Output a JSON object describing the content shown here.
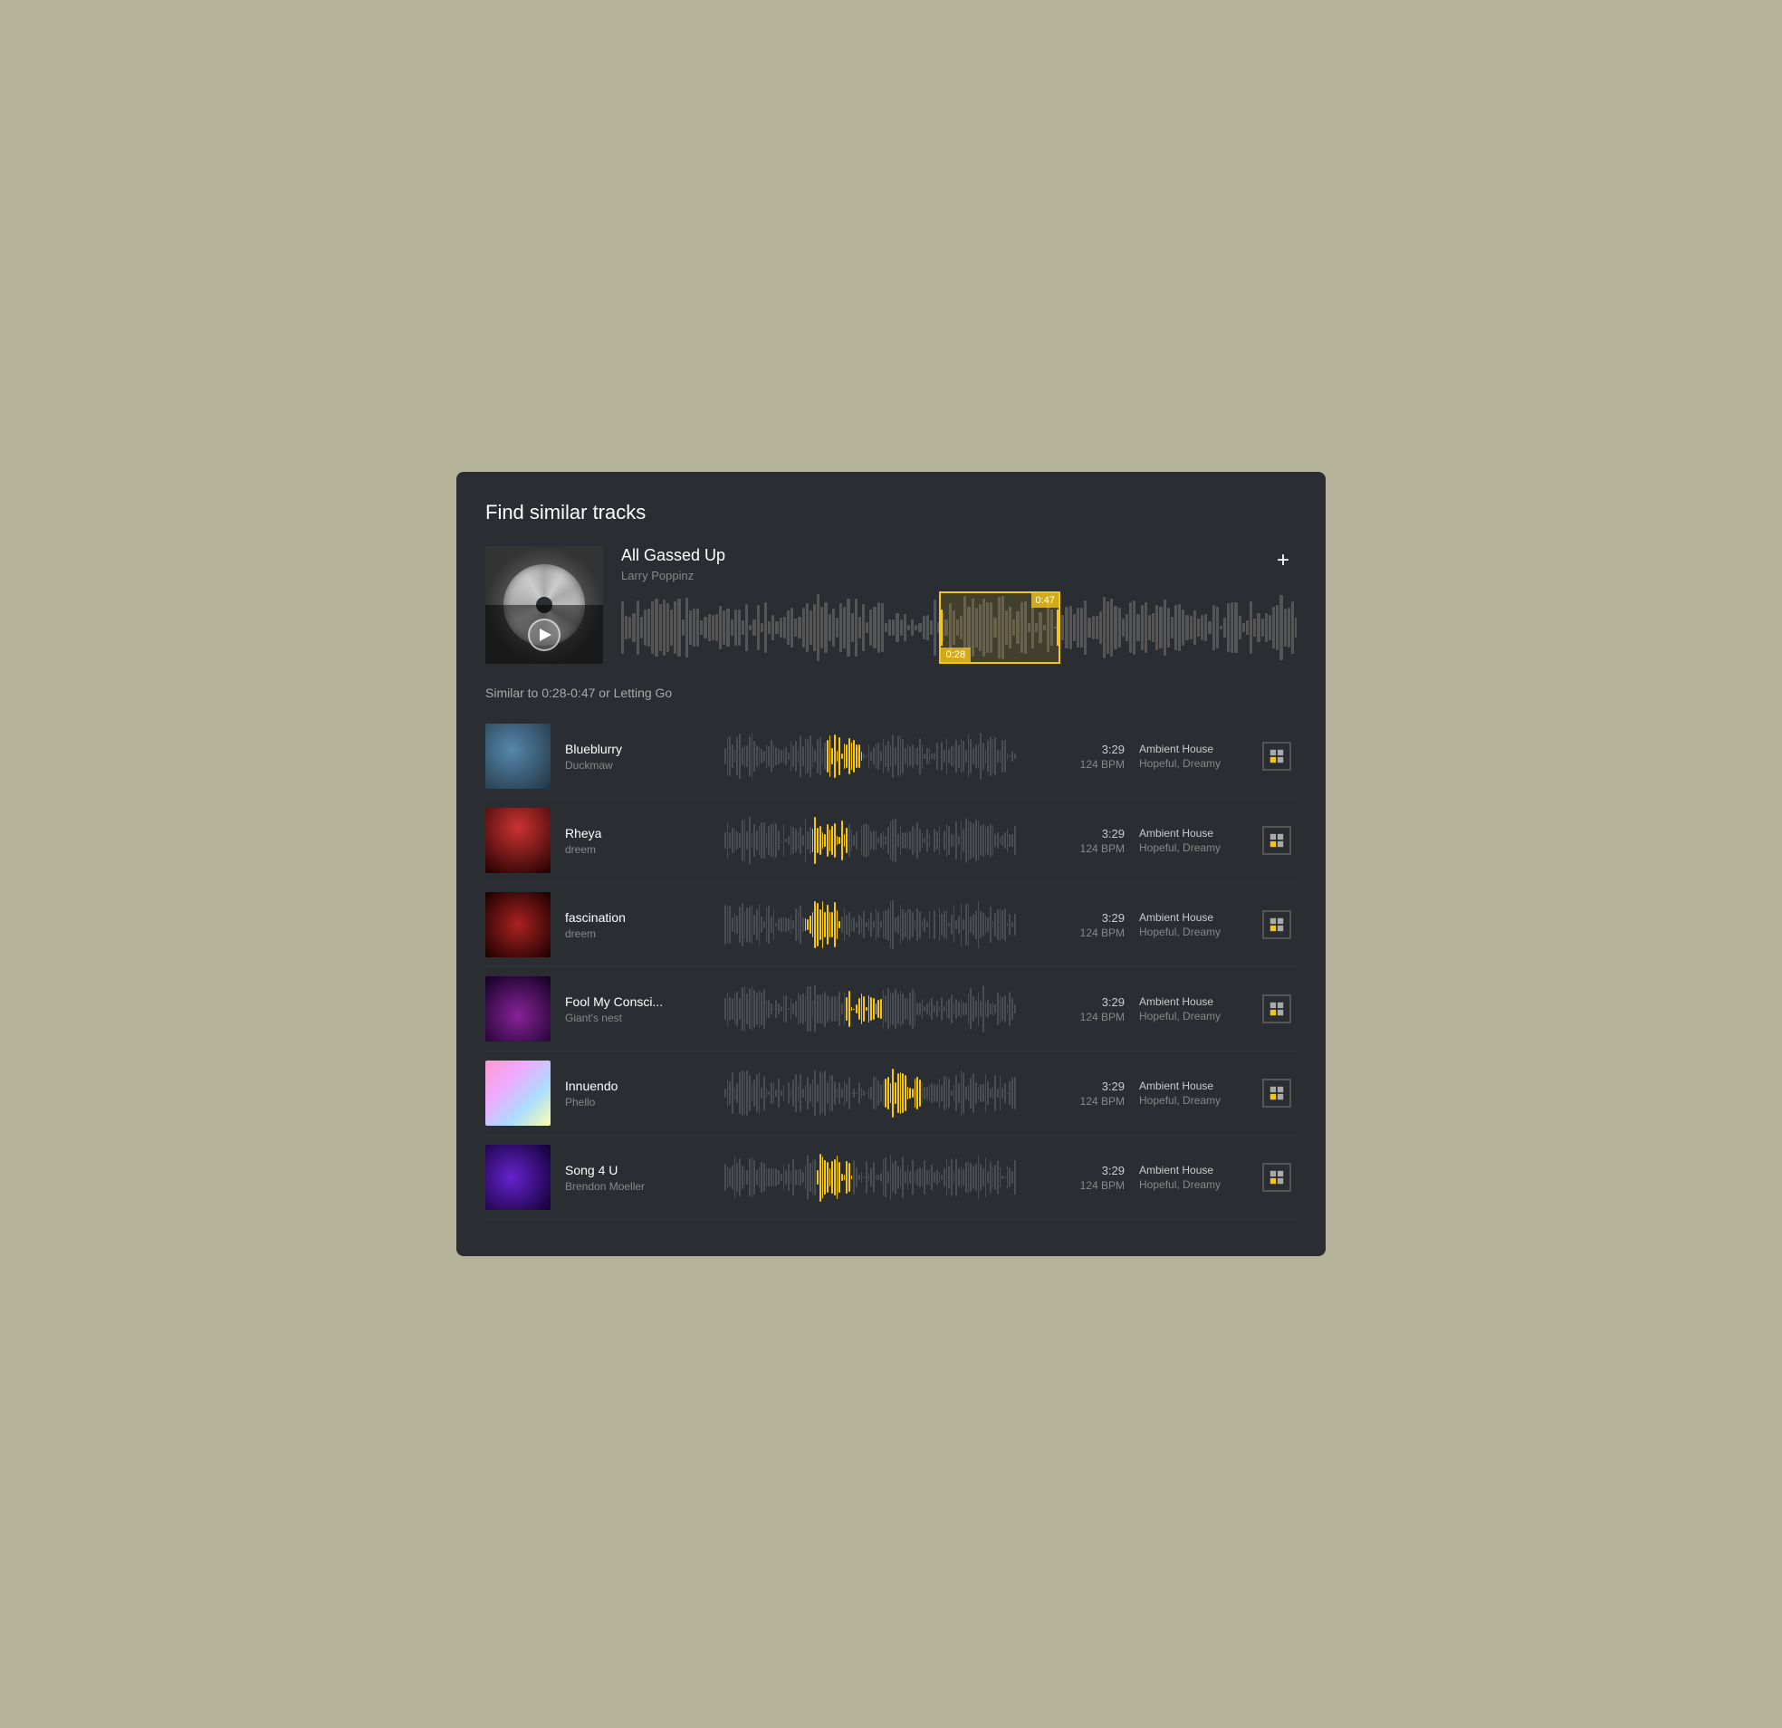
{
  "page": {
    "title": "Find similar tracks",
    "bg_color": "#b5b49a",
    "window_bg": "#2a2d31"
  },
  "hero": {
    "track_title": "All Gassed Up",
    "artist": "Larry Poppinz",
    "add_label": "+",
    "selection": {
      "start_time": "0:28",
      "end_time": "0:47"
    }
  },
  "similar_header": "Similar to 0:28-0:47 or Letting Go",
  "tracks": [
    {
      "title": "Blueblurry",
      "artist": "Duckmaw",
      "duration": "3:29",
      "bpm": "124 BPM",
      "genre": "Ambient House",
      "mood": "Hopeful, Dreamy",
      "thumb_class": "thumb-blueblurry",
      "highlight_pos": 0.35
    },
    {
      "title": "Rheya",
      "artist": "dreem",
      "duration": "3:29",
      "bpm": "124 BPM",
      "genre": "Ambient House",
      "mood": "Hopeful, Dreamy",
      "thumb_class": "thumb-rheya",
      "highlight_pos": 0.3
    },
    {
      "title": "fascination",
      "artist": "dreem",
      "duration": "3:29",
      "bpm": "124 BPM",
      "genre": "Ambient House",
      "mood": "Hopeful, Dreamy",
      "thumb_class": "thumb-fascination",
      "highlight_pos": 0.28
    },
    {
      "title": "Fool My Consci...",
      "artist": "Giant's nest",
      "duration": "3:29",
      "bpm": "124 BPM",
      "genre": "Ambient House",
      "mood": "Hopeful, Dreamy",
      "thumb_class": "thumb-fool",
      "highlight_pos": 0.42
    },
    {
      "title": "Innuendo",
      "artist": "Phello",
      "duration": "3:29",
      "bpm": "124 BPM",
      "genre": "Ambient House",
      "mood": "Hopeful, Dreamy",
      "thumb_class": "thumb-innuendo",
      "highlight_pos": 0.55
    },
    {
      "title": "Song 4 U",
      "artist": "Brendon Moeller",
      "duration": "3:29",
      "bpm": "124 BPM",
      "genre": "Ambient House",
      "mood": "Hopeful, Dreamy",
      "thumb_class": "thumb-song4u",
      "highlight_pos": 0.32
    }
  ]
}
